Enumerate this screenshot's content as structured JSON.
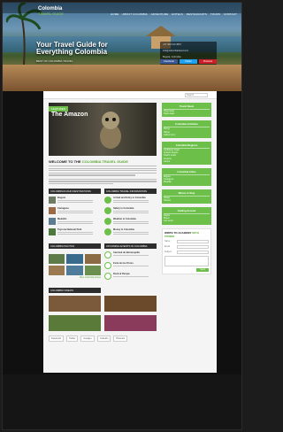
{
  "site": {
    "name": "Colombia",
    "subname": "TRAVEL GUIDE"
  },
  "nav": [
    "HOME",
    "ABOUT COLOMBIA",
    "ADVENTURE",
    "HOTELS",
    "RESTAURANTS",
    "TOURS",
    "CONTACT"
  ],
  "hero": {
    "tagline": "Your Travel Guide for Everything Colombia",
    "sub": "BEST OF COLOMBIA TRAVEL"
  },
  "contact": [
    "+57 300 123 4567",
    "info@colombiatravel.com",
    "Bogota, Colombia"
  ],
  "social": [
    "Facebook",
    "Twitter",
    "Pinterest"
  ],
  "search": {
    "placeholder": "Search"
  },
  "featured": {
    "badge": "FEATURED",
    "title": "The Amazon"
  },
  "welcome": {
    "prefix": "WELCOME TO THE",
    "highlight": "COLOMBIA TRAVEL GUIDE"
  },
  "sections": {
    "destinations": "COLOMBIAN MAIN DESTINATIONS",
    "info": "COLOMBIA TRAVEL INFORMATION",
    "photos": "COLOMBIA PHOTOS",
    "events": "UPCOMING EVENTS IN COLOMBIA",
    "videos": "COLOMBIA VIDEOS"
  },
  "destinations": [
    "Bogota",
    "Cartagena",
    "Medellin",
    "Tayrona National Park"
  ],
  "info_items": [
    "Arrival and Entry to Colombia",
    "Safety in Colombia",
    "Weather in Colombia",
    "Money in Colombia"
  ],
  "photos_more": "More Colombia photos",
  "events": [
    "Carnival de Barranquilla",
    "Feria de las Flores",
    "Rock al Parque"
  ],
  "sidebar": [
    {
      "title": "Travel Deals",
      "rows": [
        "Hotel deals",
        "Flight deals"
      ]
    },
    {
      "title": "Colombia Activities",
      "rows": [
        "Diving",
        "Hiking",
        "Coffee tours"
      ]
    },
    {
      "title": "Colombia Regions",
      "rows": [
        "Caribbean Coast",
        "Andean Region",
        "Pacific Coast",
        "Amazon",
        "Llanos"
      ]
    },
    {
      "title": "Colombia Cities",
      "rows": [
        "Bogota",
        "Cartagena",
        "Medellin"
      ]
    },
    {
      "title": "Where to Stay",
      "rows": [
        "Hotels",
        "Hostels"
      ]
    },
    {
      "title": "Getting Around",
      "rows": [
        "Flights",
        "Buses",
        "Car rental"
      ]
    }
  ],
  "form": {
    "prefix": "WRITE TO ACADEMY",
    "highlight": "WITH POWER",
    "fields": [
      "Name",
      "Email",
      "Subject"
    ],
    "submit": "Send"
  },
  "share": [
    "Facebook",
    "Twitter",
    "Google+",
    "LinkedIn",
    "Pinterest"
  ]
}
